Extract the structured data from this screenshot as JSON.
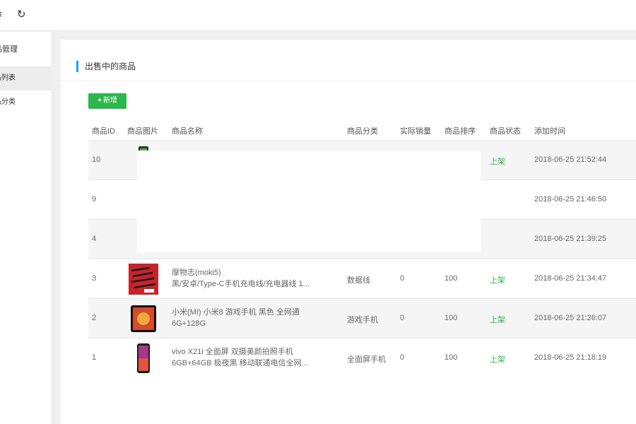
{
  "topbar": {
    "menu_icon": "≡",
    "refresh_icon": "↻"
  },
  "sidebar": {
    "title": "品管理",
    "items": [
      {
        "label": "品列表",
        "active": true
      },
      {
        "label": "品分类",
        "active": false
      }
    ]
  },
  "card": {
    "title": "出售中的商品"
  },
  "toolbar": {
    "add_label": "新增",
    "add_icon": "+"
  },
  "table": {
    "columns": [
      "商品ID",
      "商品图片",
      "商品名称",
      "商品分类",
      "实际销量",
      "商品排序",
      "商品状态",
      "添加时间"
    ],
    "rows": [
      {
        "id": "10",
        "name1": "",
        "name2": "",
        "category": "",
        "sales": "",
        "sort": "",
        "status": "上架",
        "time": "2018-06-25 21:52:44",
        "thumb": "phone-green"
      },
      {
        "id": "9",
        "name1": "",
        "name2": "",
        "category": "",
        "sales": "",
        "sort": "",
        "status": "",
        "time": "2018-06-25 21:46:50",
        "thumb": ""
      },
      {
        "id": "4",
        "name1": "",
        "name2": "",
        "category": "",
        "sales": "",
        "sort": "",
        "status": "",
        "time": "2018-06-25 21:39:25",
        "thumb": ""
      },
      {
        "id": "3",
        "name1": "摩物志(moki5)",
        "name2": "黑/安卓/Type-C手机充电线/充电器线 1...",
        "category": "数据线",
        "sales": "0",
        "sort": "100",
        "status": "上架",
        "time": "2018-06-25 21:34:47",
        "thumb": "cables-red"
      },
      {
        "id": "2",
        "name1": "小米(MI) 小米8 游戏手机 黑色 全网通",
        "name2": "6G+128G",
        "category": "游戏手机",
        "sales": "0",
        "sort": "100",
        "status": "上架",
        "time": "2018-06-25 21:26:07",
        "thumb": "phone-black"
      },
      {
        "id": "1",
        "name1": "vivo X21i 全面屏 双摄美颜拍照手机",
        "name2": "6GB+64GB 极夜黑 移动联通电信全网...",
        "category": "全面屏手机",
        "sales": "0",
        "sort": "100",
        "status": "上架",
        "time": "2018-06-25 21:18:19",
        "thumb": "phone-gradient"
      }
    ]
  },
  "colors": {
    "accent": "#1e9fff",
    "primary_button": "#2db84d",
    "status_on": "#2db84d"
  }
}
